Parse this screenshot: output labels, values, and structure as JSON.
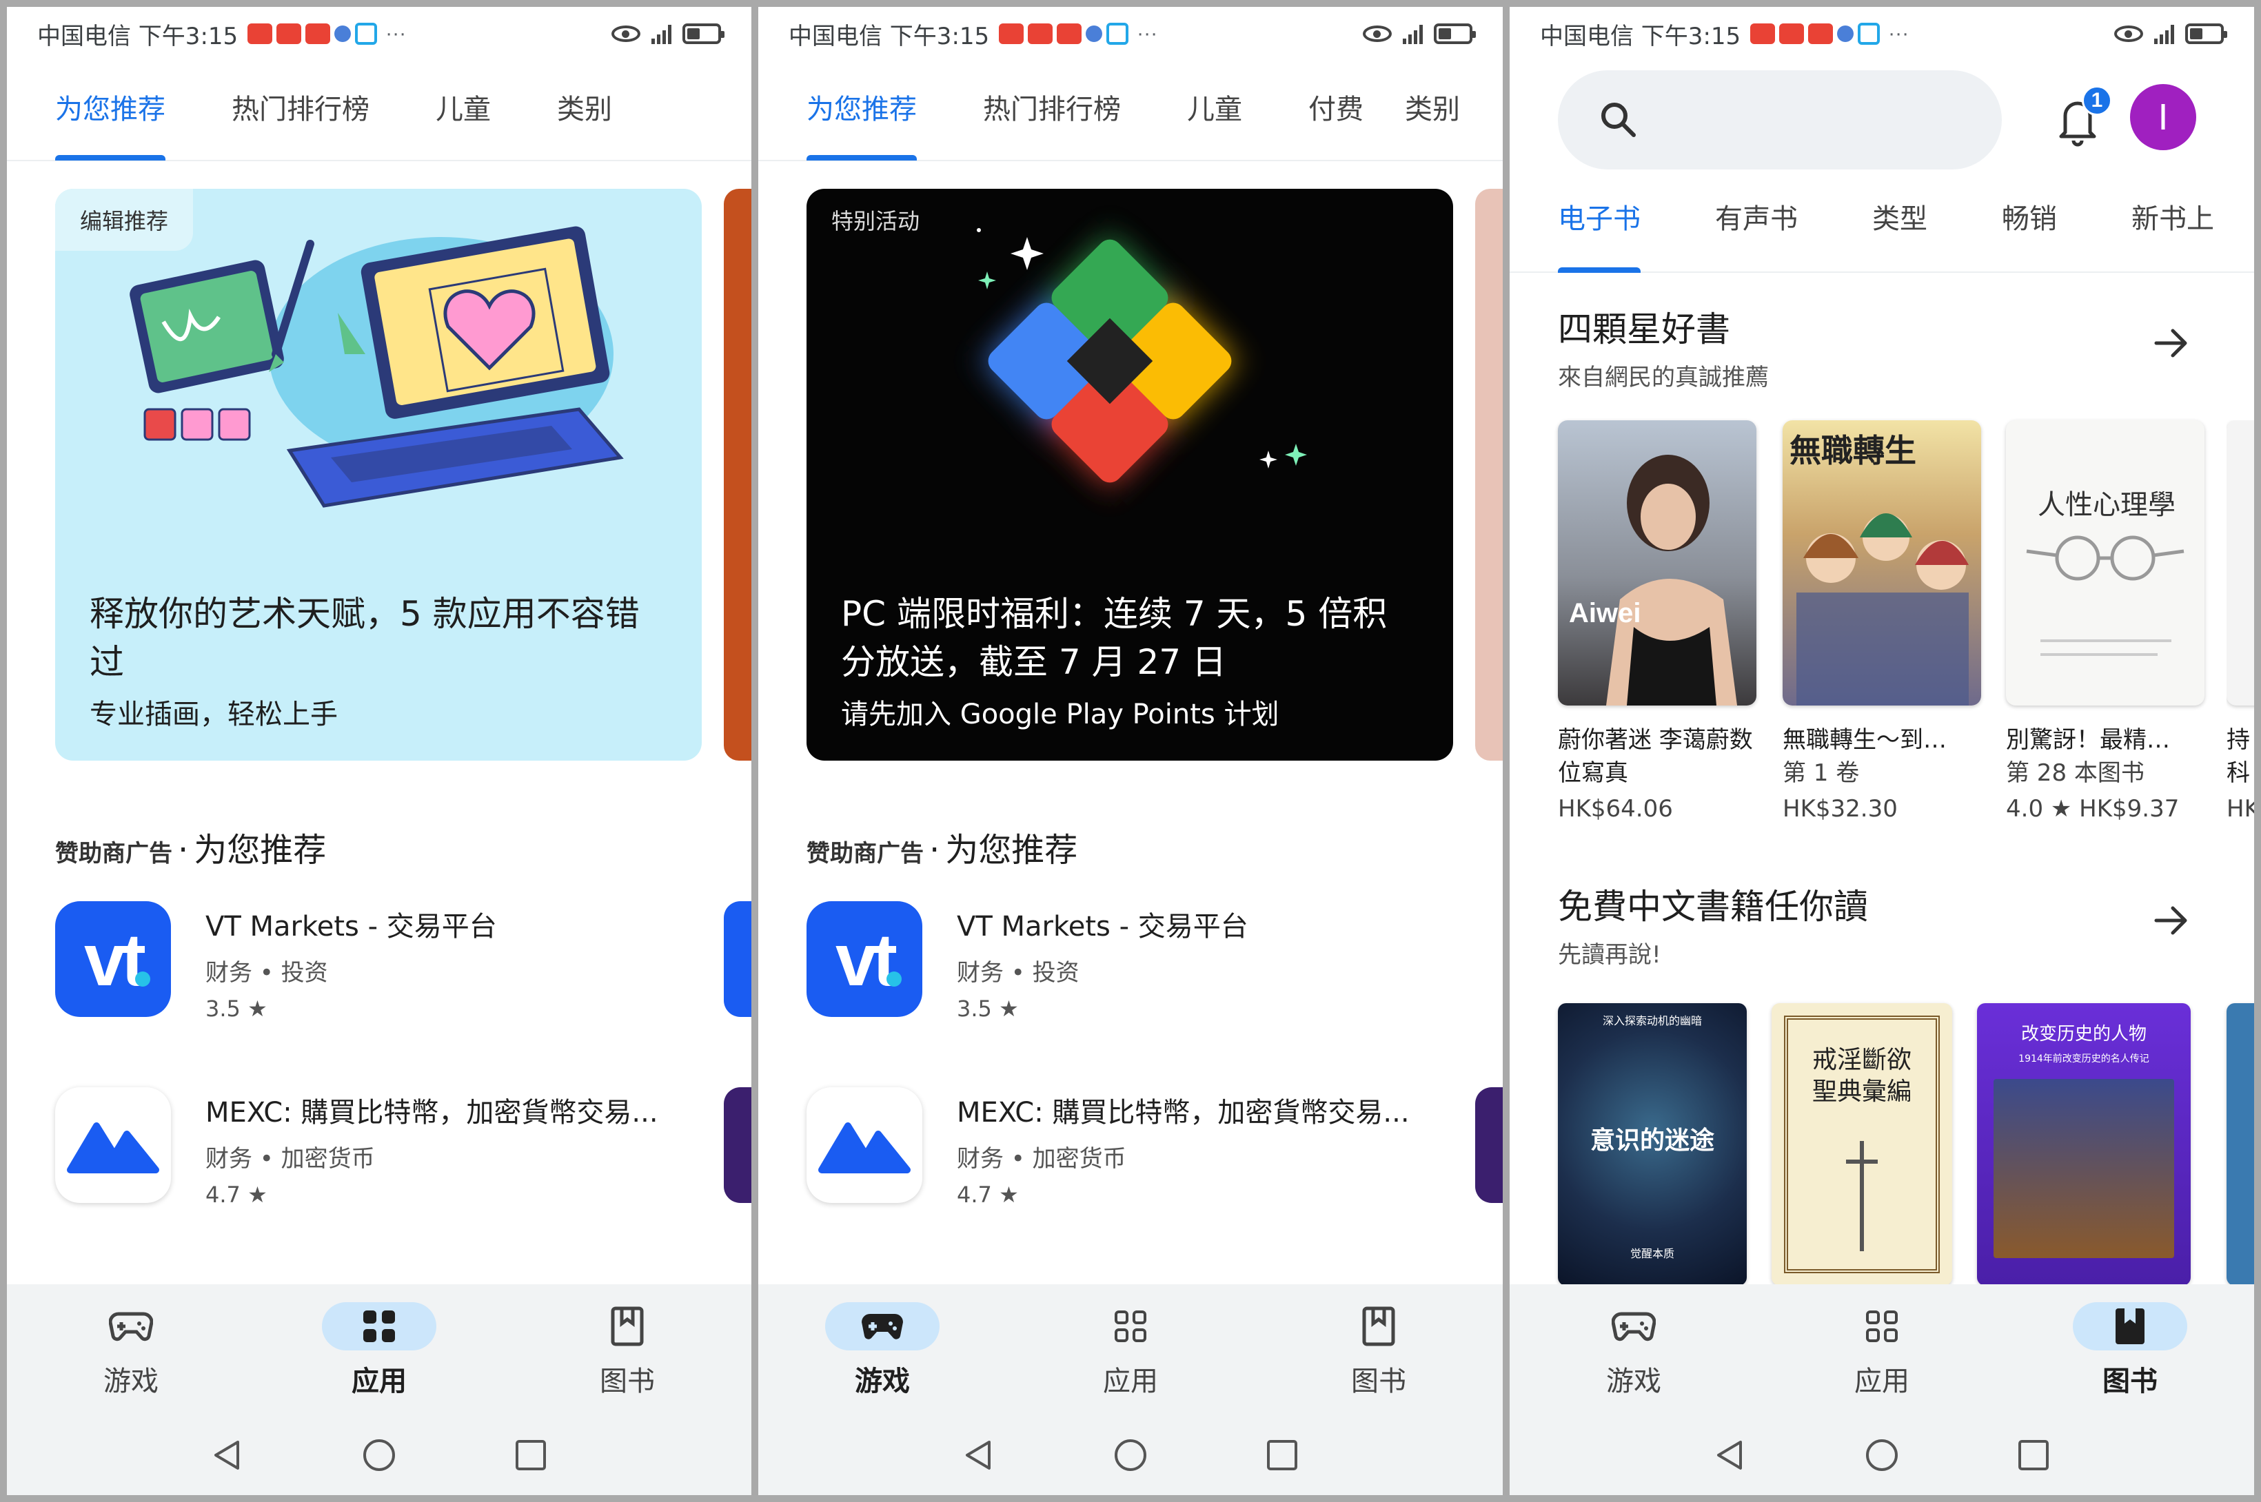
{
  "status": {
    "carrier": "中国电信 下午3:15",
    "dots": "···",
    "network": "4G"
  },
  "screen1": {
    "tabs": [
      "为您推荐",
      "热门排行榜",
      "儿童",
      "类别"
    ],
    "hero": {
      "badge": "编辑推荐",
      "title": "释放你的艺术天赋，5 款应用不容错过",
      "subtitle": "专业插画，轻松上手"
    },
    "section": {
      "sponsored": "赞助商广告",
      "dot": " · ",
      "title": "为您推荐"
    },
    "apps": [
      {
        "name": "VT Markets - 交易平台",
        "meta": "财务 • 投资",
        "rating": "3.5 ★",
        "icon_text": "vt"
      },
      {
        "name": "MEXC: 購買比特幣，加密貨幣交易...",
        "meta": "财务 • 加密货币",
        "rating": "4.7 ★"
      }
    ],
    "nav": [
      {
        "label": "游戏",
        "icon": "gamepad-icon",
        "active": false
      },
      {
        "label": "应用",
        "icon": "apps-grid-icon",
        "active": true
      },
      {
        "label": "图书",
        "icon": "bookmark-book-icon",
        "active": false
      }
    ]
  },
  "screen2": {
    "tabs": [
      "为您推荐",
      "热门排行榜",
      "儿童",
      "付费",
      "类别"
    ],
    "hero": {
      "badge": "特别活动",
      "title": "PC 端限时福利：连续 7 天，5 倍积分放送，截至 7 月 27 日",
      "subtitle": "请先加入 Google Play Points 计划"
    },
    "section": {
      "sponsored": "赞助商广告",
      "dot": " · ",
      "title": "为您推荐"
    },
    "apps": [
      {
        "name": "VT Markets - 交易平台",
        "meta": "财务 • 投资",
        "rating": "3.5 ★",
        "icon_text": "vt"
      },
      {
        "name": "MEXC: 購買比特幣，加密貨幣交易...",
        "meta": "财务 • 加密货币",
        "rating": "4.7 ★"
      }
    ],
    "nav": [
      {
        "label": "游戏",
        "icon": "gamepad-icon",
        "active": true
      },
      {
        "label": "应用",
        "icon": "apps-grid-icon",
        "active": false
      },
      {
        "label": "图书",
        "icon": "bookmark-book-icon",
        "active": false
      }
    ]
  },
  "screen3": {
    "notification_count": "1",
    "avatar_letter": "I",
    "tabs": [
      "电子书",
      "有声书",
      "类型",
      "畅销",
      "新书上"
    ],
    "section1": {
      "title": "四顆星好書",
      "subtitle": "來自網民的真誠推薦",
      "books": [
        {
          "title": "蔚你著迷 李蔼蔚数位寫真",
          "price": "HK$64.06",
          "cover_text": "Aiwei"
        },
        {
          "title": "無職轉生～到…",
          "line2": "第 1 卷",
          "price": "HK$32.30",
          "cover_text": "無職轉生"
        },
        {
          "title": "別驚訝！最精…",
          "line2": "第 28 本图书",
          "price": "4.0 ★   HK$9.37",
          "cover_text": "人性心理學"
        },
        {
          "title": "持科",
          "price": "HK"
        }
      ]
    },
    "section2": {
      "title": "免費中文書籍任你讀",
      "subtitle": "先讀再說!",
      "covers": [
        {
          "title": "意识的迷途",
          "top": "深入探索动机的幽暗",
          "bottom": "觉醒本质"
        },
        {
          "title": "戒淫斷欲聖典彙編",
          "top": "",
          "bottom": ""
        },
        {
          "title": "改变历史的人物",
          "top": "",
          "bottom": "1914年前改变历史的名人传记"
        }
      ]
    },
    "nav": [
      {
        "label": "游戏",
        "icon": "gamepad-icon",
        "active": false
      },
      {
        "label": "应用",
        "icon": "apps-grid-icon",
        "active": false
      },
      {
        "label": "图书",
        "icon": "bookmark-book-icon",
        "active": true
      }
    ]
  },
  "colors": {
    "accent": "#1a73e8",
    "nav_active_bg": "#cce6fb",
    "vt_blue": "#1a5cf2",
    "avatar": "#a020c0"
  }
}
